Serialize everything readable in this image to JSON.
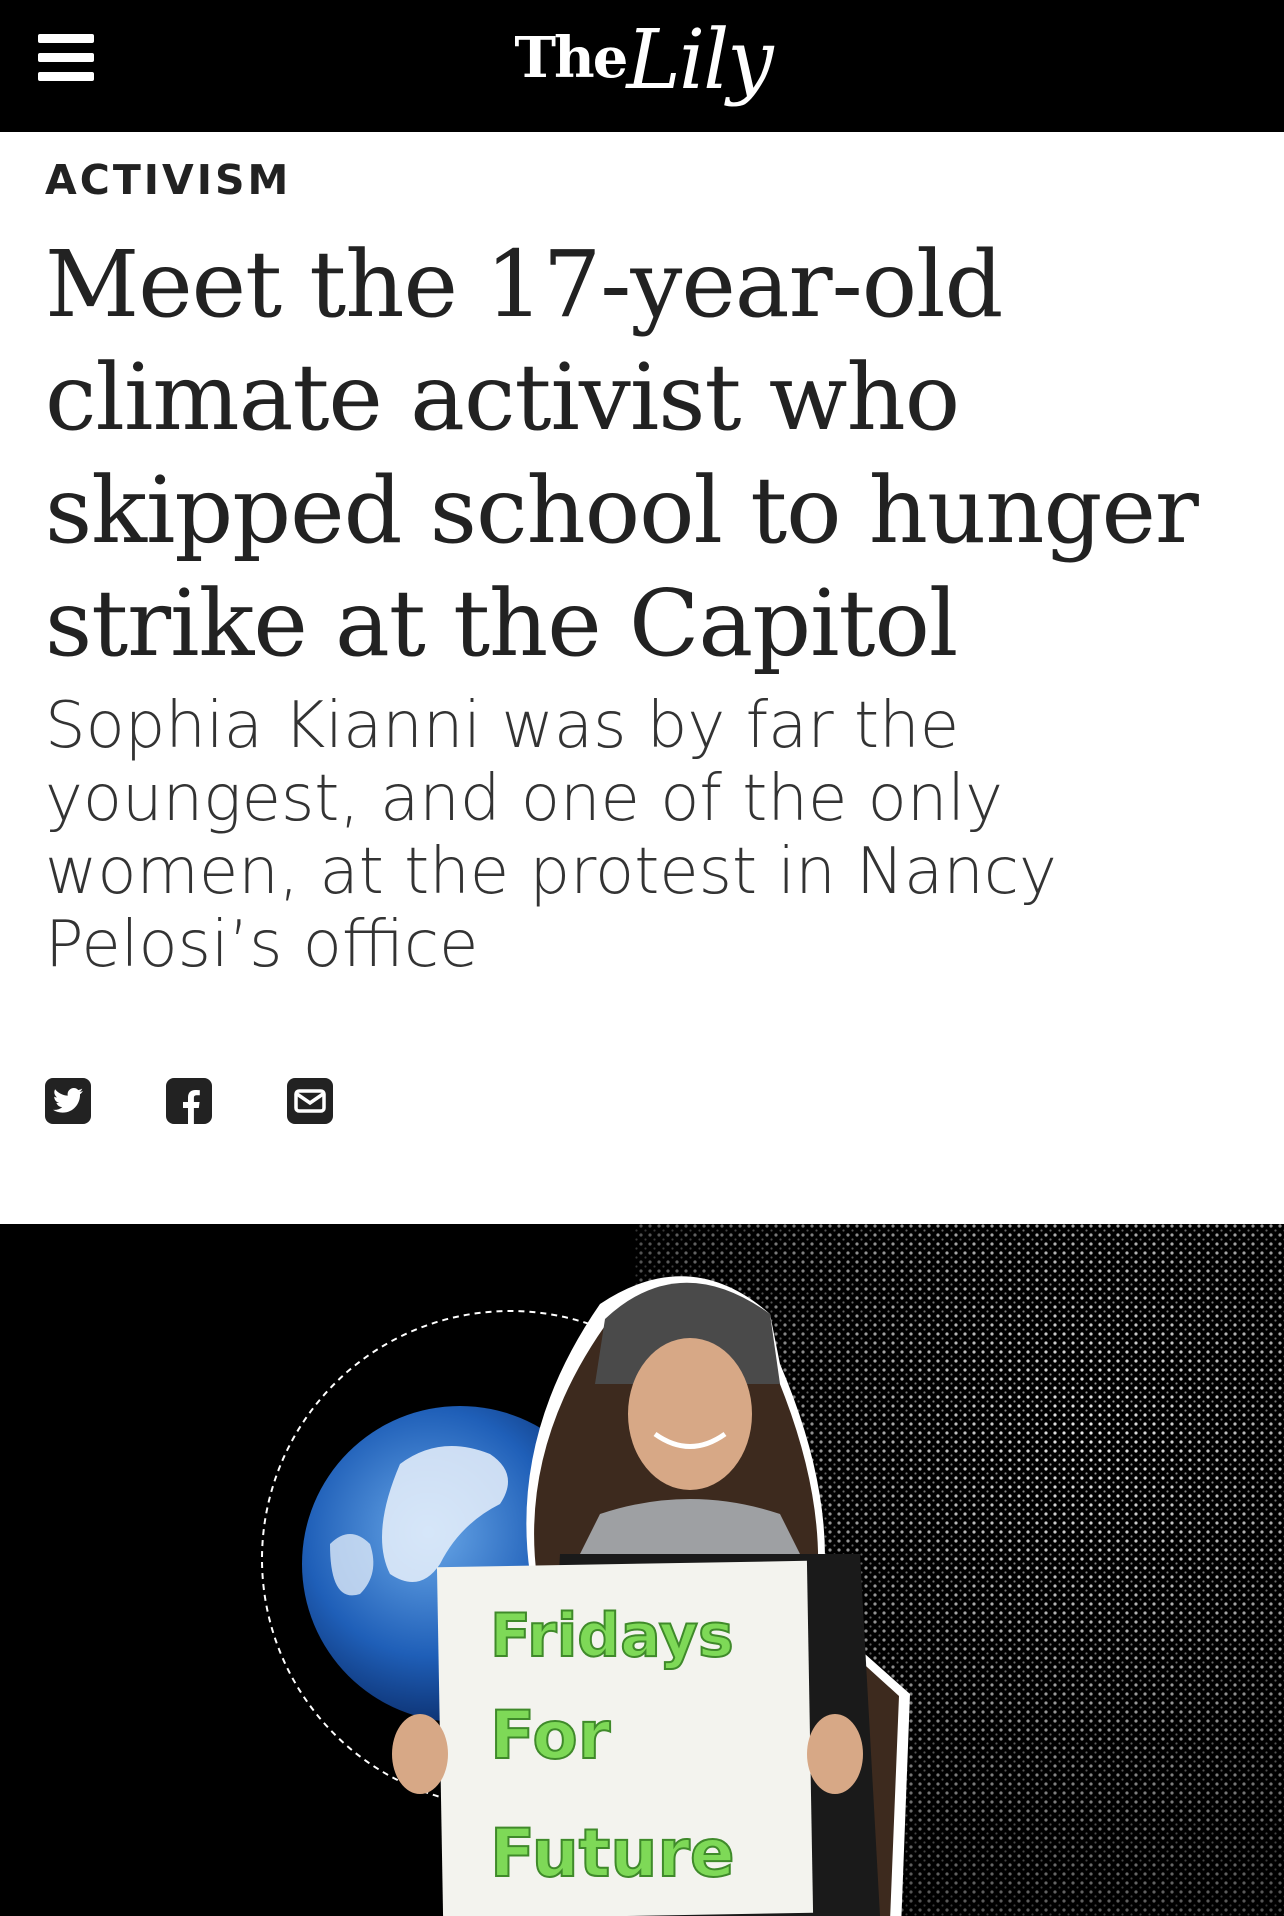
{
  "header": {
    "logo_prefix": "The",
    "logo_name": "Lily",
    "menu_icon": "hamburger-menu-icon"
  },
  "article": {
    "kicker": "ACTIVISM",
    "headline": "Meet the 17-year-old climate activist who skipped school to hunger strike at the Capitol",
    "dek": "Sophia Kianni was by far the youngest, and one of the only women, at the protest in Nancy Pelosi’s office"
  },
  "share": {
    "icons": [
      "twitter-icon",
      "facebook-icon",
      "email-icon"
    ]
  },
  "hero": {
    "sign_lines": [
      "Fridays",
      "For",
      "Future"
    ],
    "sign_color": "#7ed957"
  },
  "colors": {
    "header_bg": "#000000",
    "text": "#222222",
    "hero_bg": "#000000"
  }
}
